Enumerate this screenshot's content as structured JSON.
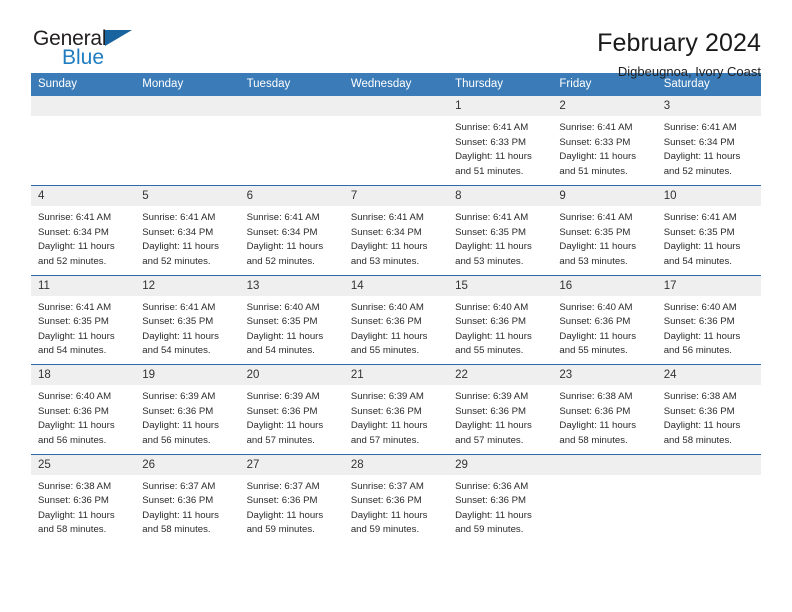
{
  "logo": {
    "primary_text": "General",
    "secondary_text": "Blue",
    "primary_color": "#231f20",
    "secondary_color": "#1f7dc0",
    "triangle_color": "#19639f"
  },
  "header": {
    "title": "February 2024",
    "subtitle": "Digbeugnoa, Ivory Coast"
  },
  "theme": {
    "header_row_bg": "#3b7cb8",
    "day_number_bg": "#efefef",
    "week_separator": "#2a6ba8"
  },
  "weekdays": [
    "Sunday",
    "Monday",
    "Tuesday",
    "Wednesday",
    "Thursday",
    "Friday",
    "Saturday"
  ],
  "weeks": [
    [
      {
        "day": "",
        "blank": true
      },
      {
        "day": "",
        "blank": true
      },
      {
        "day": "",
        "blank": true
      },
      {
        "day": "",
        "blank": true
      },
      {
        "day": "1",
        "sunrise": "Sunrise: 6:41 AM",
        "sunset": "Sunset: 6:33 PM",
        "daylight": "Daylight: 11 hours and 51 minutes."
      },
      {
        "day": "2",
        "sunrise": "Sunrise: 6:41 AM",
        "sunset": "Sunset: 6:33 PM",
        "daylight": "Daylight: 11 hours and 51 minutes."
      },
      {
        "day": "3",
        "sunrise": "Sunrise: 6:41 AM",
        "sunset": "Sunset: 6:34 PM",
        "daylight": "Daylight: 11 hours and 52 minutes."
      }
    ],
    [
      {
        "day": "4",
        "sunrise": "Sunrise: 6:41 AM",
        "sunset": "Sunset: 6:34 PM",
        "daylight": "Daylight: 11 hours and 52 minutes."
      },
      {
        "day": "5",
        "sunrise": "Sunrise: 6:41 AM",
        "sunset": "Sunset: 6:34 PM",
        "daylight": "Daylight: 11 hours and 52 minutes."
      },
      {
        "day": "6",
        "sunrise": "Sunrise: 6:41 AM",
        "sunset": "Sunset: 6:34 PM",
        "daylight": "Daylight: 11 hours and 52 minutes."
      },
      {
        "day": "7",
        "sunrise": "Sunrise: 6:41 AM",
        "sunset": "Sunset: 6:34 PM",
        "daylight": "Daylight: 11 hours and 53 minutes."
      },
      {
        "day": "8",
        "sunrise": "Sunrise: 6:41 AM",
        "sunset": "Sunset: 6:35 PM",
        "daylight": "Daylight: 11 hours and 53 minutes."
      },
      {
        "day": "9",
        "sunrise": "Sunrise: 6:41 AM",
        "sunset": "Sunset: 6:35 PM",
        "daylight": "Daylight: 11 hours and 53 minutes."
      },
      {
        "day": "10",
        "sunrise": "Sunrise: 6:41 AM",
        "sunset": "Sunset: 6:35 PM",
        "daylight": "Daylight: 11 hours and 54 minutes."
      }
    ],
    [
      {
        "day": "11",
        "sunrise": "Sunrise: 6:41 AM",
        "sunset": "Sunset: 6:35 PM",
        "daylight": "Daylight: 11 hours and 54 minutes."
      },
      {
        "day": "12",
        "sunrise": "Sunrise: 6:41 AM",
        "sunset": "Sunset: 6:35 PM",
        "daylight": "Daylight: 11 hours and 54 minutes."
      },
      {
        "day": "13",
        "sunrise": "Sunrise: 6:40 AM",
        "sunset": "Sunset: 6:35 PM",
        "daylight": "Daylight: 11 hours and 54 minutes."
      },
      {
        "day": "14",
        "sunrise": "Sunrise: 6:40 AM",
        "sunset": "Sunset: 6:36 PM",
        "daylight": "Daylight: 11 hours and 55 minutes."
      },
      {
        "day": "15",
        "sunrise": "Sunrise: 6:40 AM",
        "sunset": "Sunset: 6:36 PM",
        "daylight": "Daylight: 11 hours and 55 minutes."
      },
      {
        "day": "16",
        "sunrise": "Sunrise: 6:40 AM",
        "sunset": "Sunset: 6:36 PM",
        "daylight": "Daylight: 11 hours and 55 minutes."
      },
      {
        "day": "17",
        "sunrise": "Sunrise: 6:40 AM",
        "sunset": "Sunset: 6:36 PM",
        "daylight": "Daylight: 11 hours and 56 minutes."
      }
    ],
    [
      {
        "day": "18",
        "sunrise": "Sunrise: 6:40 AM",
        "sunset": "Sunset: 6:36 PM",
        "daylight": "Daylight: 11 hours and 56 minutes."
      },
      {
        "day": "19",
        "sunrise": "Sunrise: 6:39 AM",
        "sunset": "Sunset: 6:36 PM",
        "daylight": "Daylight: 11 hours and 56 minutes."
      },
      {
        "day": "20",
        "sunrise": "Sunrise: 6:39 AM",
        "sunset": "Sunset: 6:36 PM",
        "daylight": "Daylight: 11 hours and 57 minutes."
      },
      {
        "day": "21",
        "sunrise": "Sunrise: 6:39 AM",
        "sunset": "Sunset: 6:36 PM",
        "daylight": "Daylight: 11 hours and 57 minutes."
      },
      {
        "day": "22",
        "sunrise": "Sunrise: 6:39 AM",
        "sunset": "Sunset: 6:36 PM",
        "daylight": "Daylight: 11 hours and 57 minutes."
      },
      {
        "day": "23",
        "sunrise": "Sunrise: 6:38 AM",
        "sunset": "Sunset: 6:36 PM",
        "daylight": "Daylight: 11 hours and 58 minutes."
      },
      {
        "day": "24",
        "sunrise": "Sunrise: 6:38 AM",
        "sunset": "Sunset: 6:36 PM",
        "daylight": "Daylight: 11 hours and 58 minutes."
      }
    ],
    [
      {
        "day": "25",
        "sunrise": "Sunrise: 6:38 AM",
        "sunset": "Sunset: 6:36 PM",
        "daylight": "Daylight: 11 hours and 58 minutes."
      },
      {
        "day": "26",
        "sunrise": "Sunrise: 6:37 AM",
        "sunset": "Sunset: 6:36 PM",
        "daylight": "Daylight: 11 hours and 58 minutes."
      },
      {
        "day": "27",
        "sunrise": "Sunrise: 6:37 AM",
        "sunset": "Sunset: 6:36 PM",
        "daylight": "Daylight: 11 hours and 59 minutes."
      },
      {
        "day": "28",
        "sunrise": "Sunrise: 6:37 AM",
        "sunset": "Sunset: 6:36 PM",
        "daylight": "Daylight: 11 hours and 59 minutes."
      },
      {
        "day": "29",
        "sunrise": "Sunrise: 6:36 AM",
        "sunset": "Sunset: 6:36 PM",
        "daylight": "Daylight: 11 hours and 59 minutes."
      },
      {
        "day": "",
        "blank": true
      },
      {
        "day": "",
        "blank": true
      }
    ]
  ]
}
